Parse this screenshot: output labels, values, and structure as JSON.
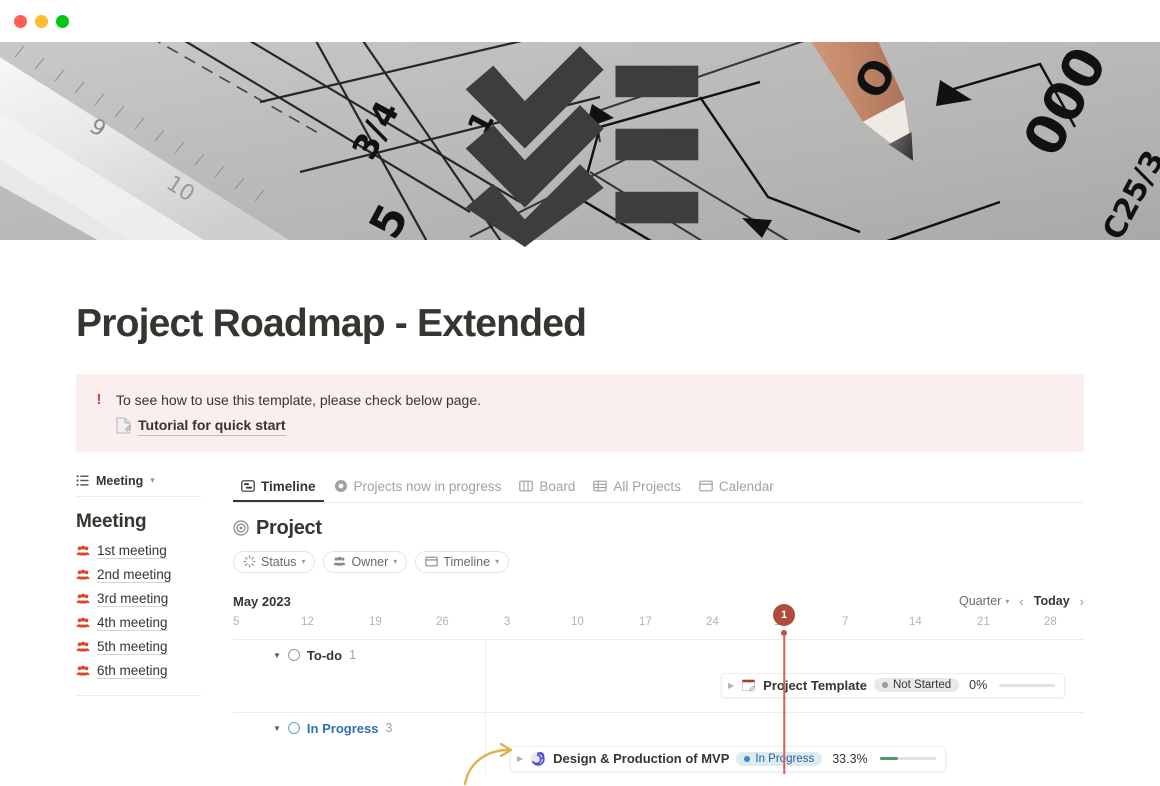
{
  "window": {
    "traffic_lights": [
      "close",
      "minimize",
      "maximize"
    ],
    "colors": {
      "close": "#ff5f57",
      "minimize": "#febc2e",
      "maximize": "#00c717"
    }
  },
  "cover": {
    "icon": "checklist-icon",
    "alt": "blueprint technical drawing with pencil and ruler"
  },
  "page": {
    "title": "Project Roadmap - Extended"
  },
  "callout": {
    "icon": "exclamation-icon",
    "text": "To see how to use this template, please check below page.",
    "link_icon": "page-icon",
    "link_label": "Tutorial for quick start",
    "background": "#fbeeee",
    "icon_color": "#e03e3e"
  },
  "sidebar": {
    "db_label": "Meeting",
    "db_icon": "list-icon",
    "db_chevron": "chevron-down-icon",
    "list_title": "Meeting",
    "items": [
      {
        "icon": "people-icon",
        "label": "1st meeting"
      },
      {
        "icon": "people-icon",
        "label": "2nd meeting"
      },
      {
        "icon": "people-icon",
        "label": "3rd meeting"
      },
      {
        "icon": "people-icon",
        "label": "4th meeting"
      },
      {
        "icon": "people-icon",
        "label": "5th meeting"
      },
      {
        "icon": "people-icon",
        "label": "6th meeting"
      }
    ]
  },
  "tabs": [
    {
      "icon": "timeline-icon",
      "label": "Timeline",
      "active": true
    },
    {
      "icon": "target-icon",
      "label": "Projects now in progress",
      "active": false
    },
    {
      "icon": "board-icon",
      "label": "Board",
      "active": false
    },
    {
      "icon": "table-icon",
      "label": "All Projects",
      "active": false
    },
    {
      "icon": "calendar-icon",
      "label": "Calendar",
      "active": false
    }
  ],
  "database": {
    "icon": "target-icon",
    "title": "Project",
    "filters": [
      {
        "icon": "status-icon",
        "label": "Status",
        "chevron": "chevron-down-icon"
      },
      {
        "icon": "people-icon",
        "label": "Owner",
        "chevron": "chevron-down-icon"
      },
      {
        "icon": "calendar-icon",
        "label": "Timeline",
        "chevron": "chevron-down-icon"
      }
    ]
  },
  "timeline": {
    "month": "May 2023",
    "zoom_level": "Quarter",
    "zoom_chevron": "chevron-down-icon",
    "prev_label": "‹",
    "today_label": "Today",
    "next_label": "›",
    "ticks": [
      "5",
      "12",
      "19",
      "26",
      "3",
      "10",
      "17",
      "24",
      "1",
      "7",
      "14",
      "21",
      "28"
    ],
    "today_marker": {
      "label": "1",
      "color": "#b04a3d"
    },
    "groups": [
      {
        "name": "To-do",
        "count": "1",
        "ring_color": "#9b9a97",
        "label_color": "#37352f",
        "items": [
          {
            "expand": "collapsed-triangle-icon",
            "icon": "project-template-icon",
            "name": "Project Template",
            "status": "Not Started",
            "status_style": "gray",
            "percent": "0%",
            "progress": 0
          }
        ]
      },
      {
        "name": "In Progress",
        "count": "3",
        "ring_color": "#6b9fd4",
        "label_color": "#2e6fb5",
        "items": [
          {
            "expand": "collapsed-triangle-icon",
            "icon": "spiral-icon",
            "name": "Design & Production of MVP",
            "status": "In Progress",
            "status_style": "blue",
            "percent": "33.3%",
            "progress": 33.3
          }
        ]
      }
    ]
  },
  "annotation": {
    "type": "curved-arrow",
    "color": "#e0b253",
    "points_to": "Design & Production of MVP"
  }
}
